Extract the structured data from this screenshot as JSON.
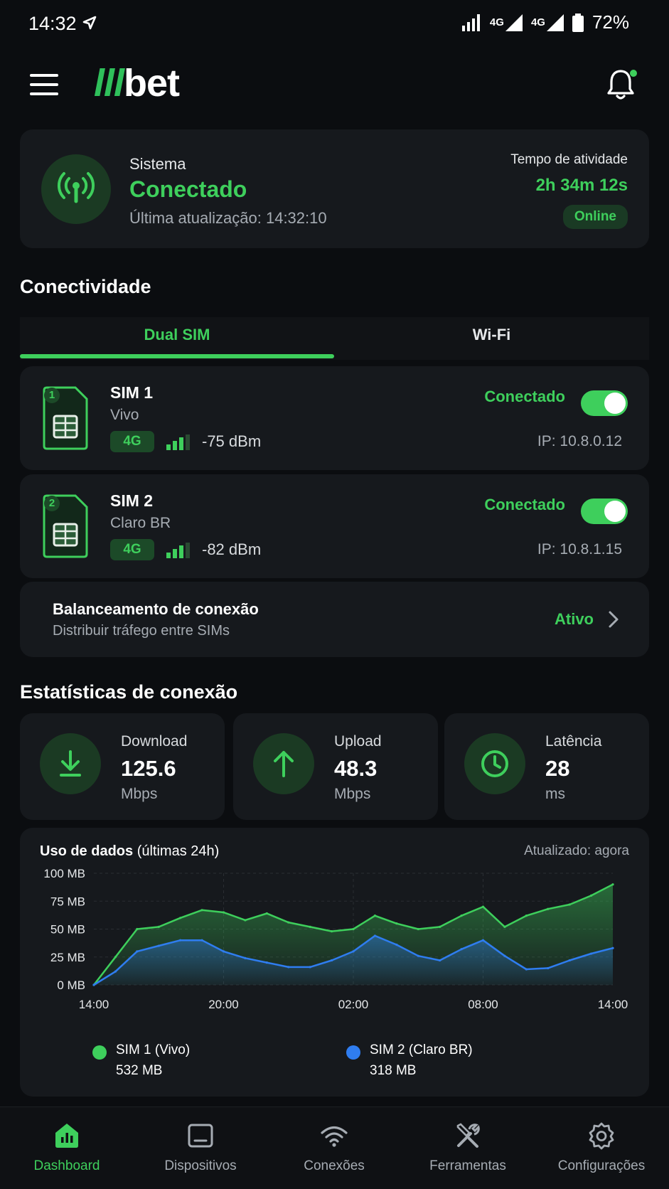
{
  "status_bar": {
    "time": "14:32",
    "network_1": "4G",
    "network_2": "4G",
    "battery": "72%"
  },
  "header": {
    "logo_part1": "lll",
    "logo_part2": "bet"
  },
  "system": {
    "label": "Sistema",
    "status": "Conectado",
    "last_update": "Última atualização: 14:32:10",
    "uptime_label": "Tempo de atividade",
    "uptime_value": "2h 34m 12s",
    "badge": "Online"
  },
  "connectivity": {
    "title": "Conectividade",
    "tabs": [
      {
        "label": "Dual SIM",
        "active": true
      },
      {
        "label": "Wi-Fi",
        "active": false
      }
    ],
    "sims": [
      {
        "number": "1",
        "name": "SIM 1",
        "carrier": "Vivo",
        "network": "4G",
        "signal": "-75 dBm",
        "status": "Conectado",
        "ip": "IP: 10.8.0.12",
        "enabled": true
      },
      {
        "number": "2",
        "name": "SIM 2",
        "carrier": "Claro BR",
        "network": "4G",
        "signal": "-82 dBm",
        "status": "Conectado",
        "ip": "IP: 10.8.1.15",
        "enabled": true
      }
    ],
    "balance": {
      "title": "Balanceamento de conexão",
      "subtitle": "Distribuir tráfego entre SIMs",
      "status": "Ativo"
    }
  },
  "stats": {
    "title": "Estatísticas de conexão",
    "items": [
      {
        "label": "Download",
        "value": "125.6",
        "unit": "Mbps",
        "icon": "download-icon"
      },
      {
        "label": "Upload",
        "value": "48.3",
        "unit": "Mbps",
        "icon": "upload-icon"
      },
      {
        "label": "Latência",
        "value": "28",
        "unit": "ms",
        "icon": "clock-icon"
      }
    ]
  },
  "chart_data": {
    "type": "area",
    "title": "Uso de dados",
    "subtitle": "(últimas 24h)",
    "updated": "Atualizado: agora",
    "x": [
      "14:00",
      "15:00",
      "16:00",
      "17:00",
      "18:00",
      "19:00",
      "20:00",
      "21:00",
      "22:00",
      "23:00",
      "00:00",
      "01:00",
      "02:00",
      "03:00",
      "04:00",
      "05:00",
      "06:00",
      "07:00",
      "08:00",
      "09:00",
      "10:00",
      "11:00",
      "12:00",
      "13:00",
      "14:00"
    ],
    "xticks": [
      "14:00",
      "20:00",
      "02:00",
      "08:00",
      "14:00"
    ],
    "yticks": [
      "0 MB",
      "25 MB",
      "50 MB",
      "75 MB",
      "100 MB"
    ],
    "ylim": [
      0,
      100
    ],
    "grid": true,
    "series": [
      {
        "name": "SIM 1 (Vivo)",
        "total": "532 MB",
        "color": "#3ecf5c",
        "values": [
          0,
          25,
          50,
          52,
          60,
          67,
          65,
          58,
          64,
          56,
          52,
          48,
          50,
          62,
          55,
          50,
          52,
          62,
          70,
          52,
          62,
          68,
          72,
          80,
          90
        ]
      },
      {
        "name": "SIM 2 (Claro BR)",
        "total": "318 MB",
        "color": "#2f7df0",
        "values": [
          0,
          12,
          30,
          35,
          40,
          40,
          30,
          24,
          20,
          16,
          16,
          22,
          30,
          44,
          36,
          26,
          22,
          32,
          40,
          26,
          14,
          15,
          22,
          28,
          33
        ]
      }
    ]
  },
  "bottom_nav": {
    "items": [
      {
        "label": "Dashboard",
        "icon": "dashboard-icon",
        "active": true
      },
      {
        "label": "Dispositivos",
        "icon": "devices-icon",
        "active": false
      },
      {
        "label": "Conexões",
        "icon": "wifi-icon",
        "active": false
      },
      {
        "label": "Ferramentas",
        "icon": "tools-icon",
        "active": false
      },
      {
        "label": "Configurações",
        "icon": "settings-icon",
        "active": false
      }
    ]
  }
}
